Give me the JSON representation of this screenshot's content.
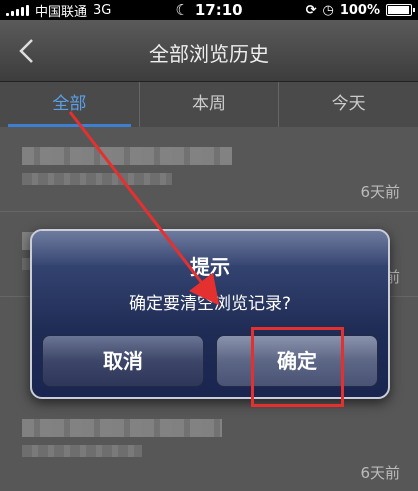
{
  "status_bar": {
    "carrier": "中国联通",
    "network": "3G",
    "time": "17:10",
    "battery_percent": "100%",
    "battery_level": 1.0
  },
  "nav": {
    "title": "全部浏览历史"
  },
  "tabs": [
    {
      "label": "全部",
      "active": true
    },
    {
      "label": "本周",
      "active": false
    },
    {
      "label": "今天",
      "active": false
    }
  ],
  "history_items": [
    {
      "time": "6天前"
    },
    {
      "time": "6天前"
    },
    {
      "time": "6天前"
    }
  ],
  "dialog": {
    "title": "提示",
    "message": "确定要清空浏览记录?",
    "cancel_label": "取消",
    "confirm_label": "确定"
  },
  "colors": {
    "tab_active": "#5aa0e8",
    "annotation_red": "#e53030",
    "dialog_bg": "#1f2c55"
  }
}
